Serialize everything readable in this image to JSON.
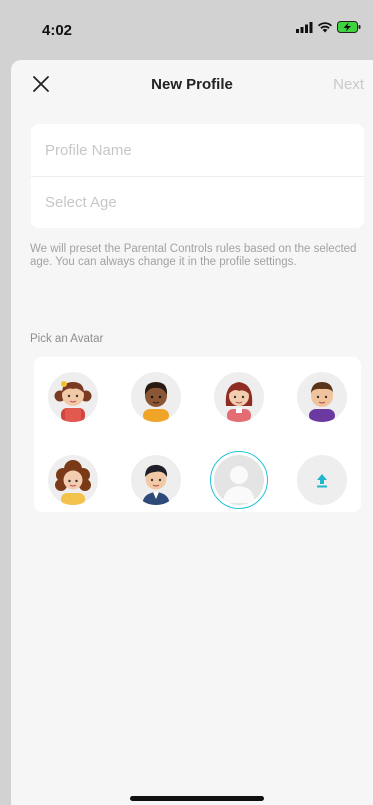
{
  "status_bar": {
    "time": "4:02"
  },
  "nav": {
    "title": "New Profile",
    "next_label": "Next"
  },
  "form": {
    "profile_name_placeholder": "Profile Name",
    "select_age_placeholder": "Select Age"
  },
  "preset_text": "We will preset the Parental Controls rules based on the selected age. You can always change it in the profile settings.",
  "avatars": {
    "heading": "Pick an Avatar",
    "selected": "default-silhouette"
  },
  "colors": {
    "accent": "#23c2d8",
    "upload_arrow": "#1fb7cd"
  }
}
